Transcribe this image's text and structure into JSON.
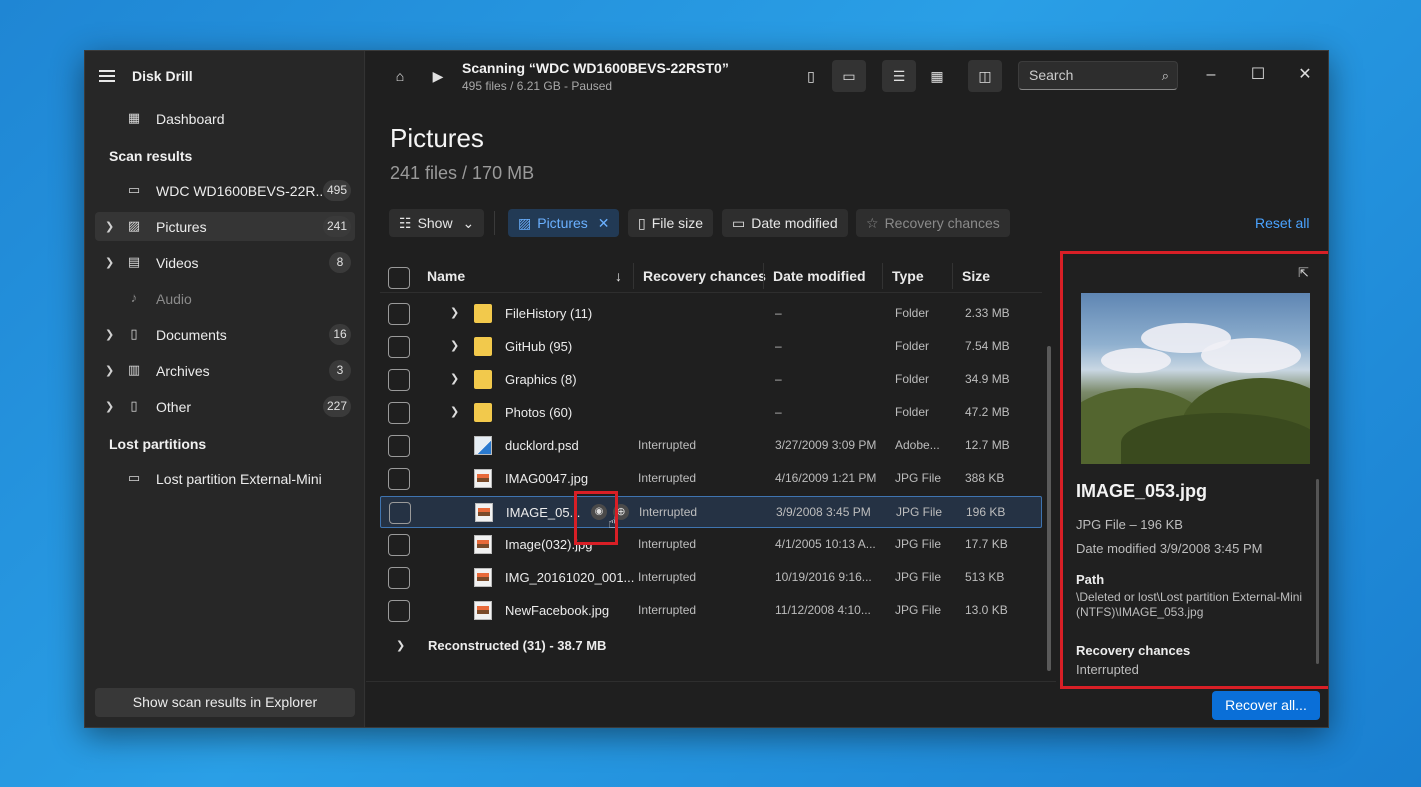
{
  "app": {
    "title": "Disk Drill"
  },
  "sidebar": {
    "dashboard": "Dashboard",
    "scan_results_heading": "Scan results",
    "lost_partitions_heading": "Lost partitions",
    "drive": {
      "label": "WDC WD1600BEVS-22R...",
      "count": "495"
    },
    "items": [
      {
        "label": "Pictures",
        "count": "241",
        "icon": "picture-icon",
        "active": true
      },
      {
        "label": "Videos",
        "count": "8",
        "icon": "film-icon"
      },
      {
        "label": "Audio",
        "count": "",
        "icon": "music-icon",
        "dim": true
      },
      {
        "label": "Documents",
        "count": "16",
        "icon": "document-icon"
      },
      {
        "label": "Archives",
        "count": "3",
        "icon": "archive-icon"
      },
      {
        "label": "Other",
        "count": "227",
        "icon": "other-file-icon"
      }
    ],
    "lost_partition": "Lost partition External-Mini (...",
    "bottom_button": "Show scan results in Explorer"
  },
  "topbar": {
    "scan_title": "Scanning “WDC WD1600BEVS-22RST0”",
    "scan_subtitle": "495 files / 6.21 GB - Paused",
    "search_placeholder": "Search"
  },
  "page": {
    "title": "Pictures",
    "subtitle": "241 files / 170 MB"
  },
  "filters": {
    "show": "Show",
    "pictures": "Pictures",
    "file_size": "File size",
    "date_modified": "Date modified",
    "recovery_chances": "Recovery chances",
    "reset_all": "Reset all"
  },
  "table": {
    "headers": {
      "name": "Name",
      "recovery": "Recovery chances",
      "date": "Date modified",
      "type": "Type",
      "size": "Size"
    },
    "rows": [
      {
        "name": "FileHistory (11)",
        "rc": "",
        "date": "–",
        "type": "Folder",
        "size": "2.33 MB",
        "kind": "folder"
      },
      {
        "name": "GitHub (95)",
        "rc": "",
        "date": "–",
        "type": "Folder",
        "size": "7.54 MB",
        "kind": "folder"
      },
      {
        "name": "Graphics (8)",
        "rc": "",
        "date": "–",
        "type": "Folder",
        "size": "34.9 MB",
        "kind": "folder"
      },
      {
        "name": "Photos (60)",
        "rc": "",
        "date": "–",
        "type": "Folder",
        "size": "47.2 MB",
        "kind": "folder"
      },
      {
        "name": "ducklord.psd",
        "rc": "Interrupted",
        "date": "3/27/2009 3:09 PM",
        "type": "Adobe...",
        "size": "12.7 MB",
        "kind": "psd"
      },
      {
        "name": "IMAG0047.jpg",
        "rc": "Interrupted",
        "date": "4/16/2009 1:21 PM",
        "type": "JPG File",
        "size": "388 KB",
        "kind": "img"
      },
      {
        "name": "IMAGE_05...",
        "rc": "Interrupted",
        "date": "3/9/2008 3:45 PM",
        "type": "JPG File",
        "size": "196 KB",
        "kind": "img",
        "selected": true
      },
      {
        "name": "Image(032).jpg",
        "rc": "Interrupted",
        "date": "4/1/2005 10:13 A...",
        "type": "JPG File",
        "size": "17.7 KB",
        "kind": "img"
      },
      {
        "name": "IMG_20161020_001...",
        "rc": "Interrupted",
        "date": "10/19/2016 9:16...",
        "type": "JPG File",
        "size": "513 KB",
        "kind": "img"
      },
      {
        "name": "NewFacebook.jpg",
        "rc": "Interrupted",
        "date": "11/12/2008 4:10...",
        "type": "JPG File",
        "size": "13.0 KB",
        "kind": "img"
      }
    ],
    "reconstructed": "Reconstructed (31) - 38.7 MB"
  },
  "preview": {
    "name": "IMAGE_053.jpg",
    "type_size": "JPG File – 196 KB",
    "date": "Date modified 3/9/2008 3:45 PM",
    "path_heading": "Path",
    "path": "\\Deleted or lost\\Lost partition External-Mini (NTFS)\\IMAGE_053.jpg",
    "recovery_heading": "Recovery chances",
    "recovery_value": "Interrupted"
  },
  "recover_button": "Recover all...",
  "colors": {
    "accent": "#0a6fd8",
    "highlight": "#d81f26",
    "folder": "#f2c94c"
  }
}
